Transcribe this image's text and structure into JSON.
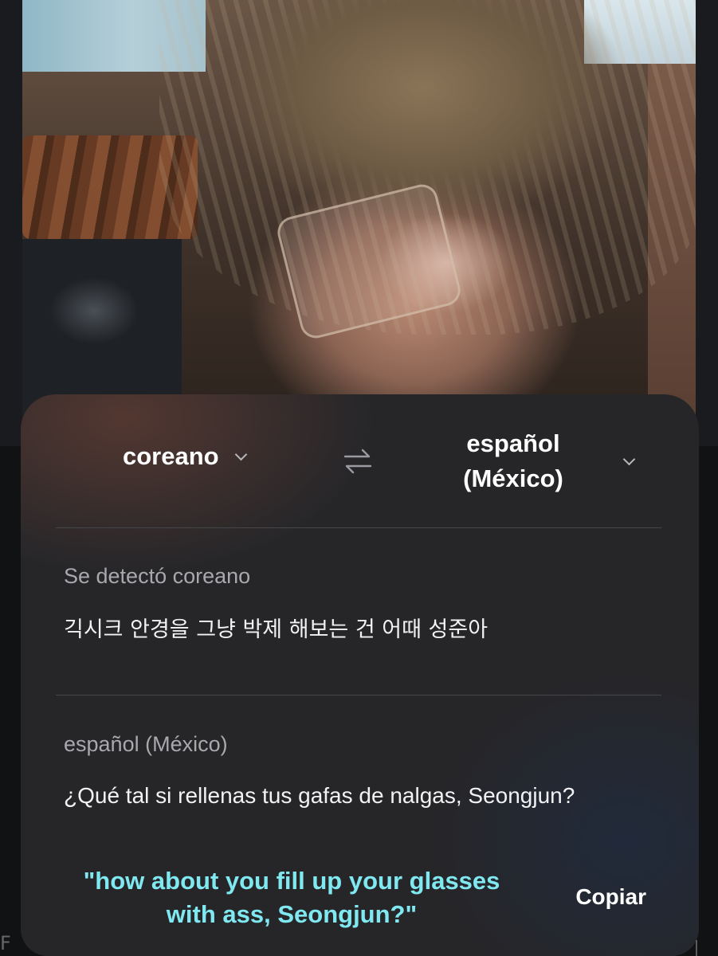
{
  "translation": {
    "source_language": "coreano",
    "target_language_line1": "español",
    "target_language_line2": "(México)",
    "detected_label": "Se detectó coreano",
    "source_text": "긱시크 안경을 그냥 박제 해보는 건 어때 성준아",
    "target_label": "español (México)",
    "translated_text": "¿Qué tal si rellenas tus gafas de nalgas, Seongjun?",
    "copy_label": "Copiar"
  },
  "overlay": {
    "caption_line1": "\"how about you fill up your glasses",
    "caption_line2": "with ass, Seongjun?\"",
    "caption_color": "#7fe8f0"
  },
  "icons": {
    "swap": "swap-arrows-icon",
    "dropdown": "chevron-down-icon"
  }
}
